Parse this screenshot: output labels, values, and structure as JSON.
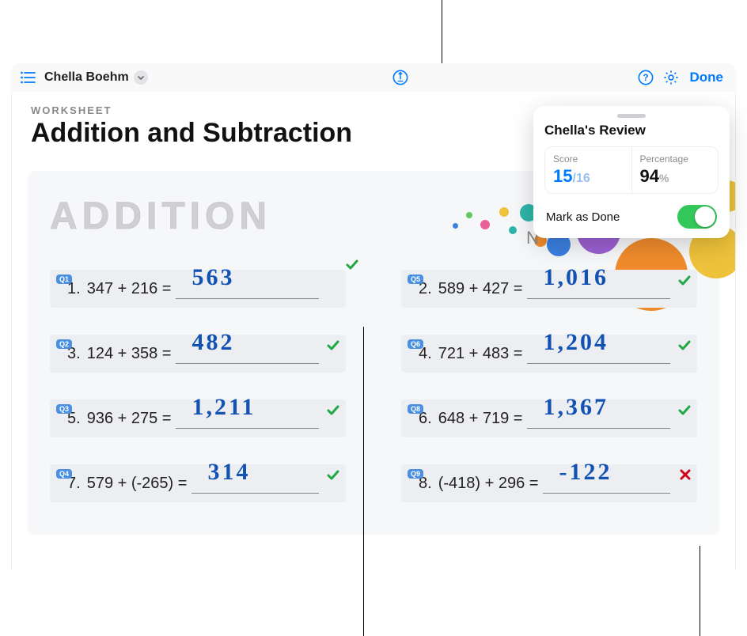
{
  "toolbar": {
    "student_name": "Chella Boehm",
    "done_label": "Done"
  },
  "header": {
    "overline": "WORKSHEET",
    "title": "Addition and Subtraction"
  },
  "section_heading": "ADDITION",
  "review": {
    "title": "Chella's Review",
    "score_label": "Score",
    "score_earned": "15",
    "score_total": "16",
    "percentage_label": "Percentage",
    "percentage_value": "94",
    "percentage_symbol": "%",
    "mark_done_label": "Mark as Done",
    "mark_done_on": true
  },
  "questions": {
    "left": [
      {
        "badge": "Q1",
        "num": "1.",
        "text": "347 + 216 =",
        "answer": "563",
        "correct": true,
        "mark_outside": true
      },
      {
        "badge": "Q2",
        "num": "3.",
        "text": "124 + 358 =",
        "answer": "482",
        "correct": true
      },
      {
        "badge": "Q3",
        "num": "5.",
        "text": "936 + 275 =",
        "answer": "1,211",
        "correct": true
      },
      {
        "badge": "Q4",
        "num": "7.",
        "text": "579 + (-265) =",
        "answer": "314",
        "correct": true
      }
    ],
    "right": [
      {
        "badge": "Q5",
        "num": "2.",
        "text": "589 + 427 =",
        "answer": "1,016",
        "correct": true
      },
      {
        "badge": "Q6",
        "num": "4.",
        "text": "721 + 483 =",
        "answer": "1,204",
        "correct": true
      },
      {
        "badge": "Q8",
        "num": "6.",
        "text": "648 + 719 =",
        "answer": "1,367",
        "correct": true
      },
      {
        "badge": "Q9",
        "num": "8.",
        "text": "(-418) + 296 =",
        "answer": "-122",
        "correct": false
      }
    ]
  },
  "bubble_colors": {
    "teal": "#2fb5a8",
    "green": "#63c861",
    "blue": "#3b7fe0",
    "purple": "#9b5fd0",
    "pink": "#e85f9a",
    "red": "#e04a3f",
    "orange": "#ef8b2c",
    "yellow": "#eec23b"
  }
}
